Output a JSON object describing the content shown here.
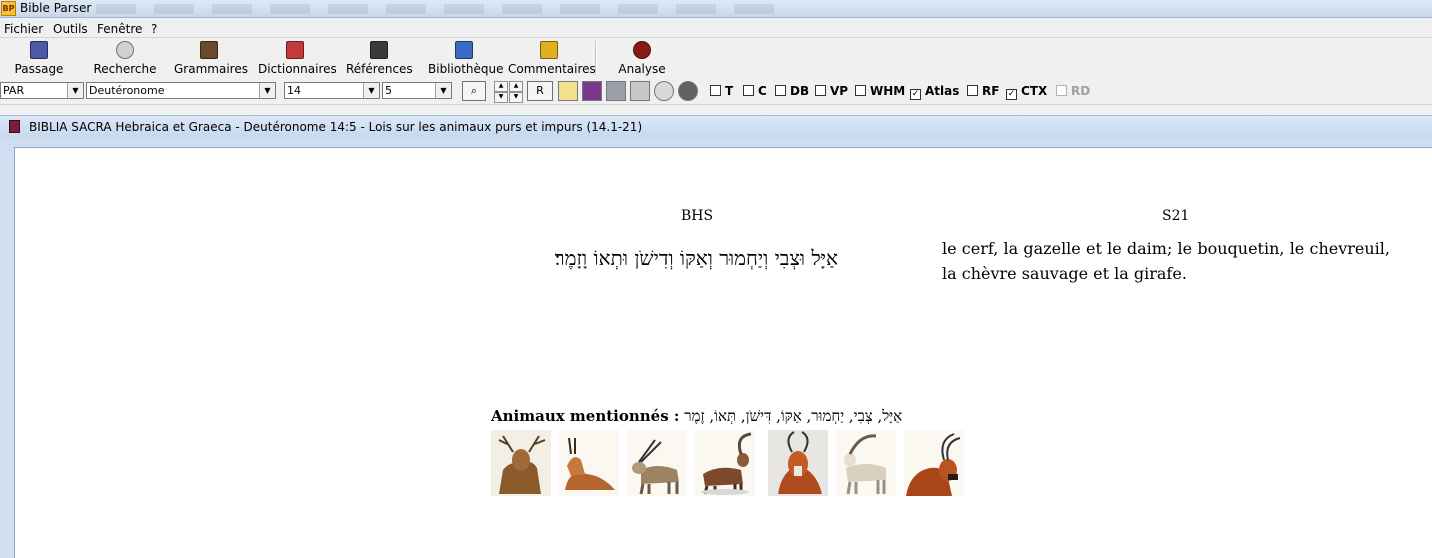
{
  "window": {
    "title": "Bible Parser",
    "app_icon_text": "BP"
  },
  "menu": [
    "Fichier",
    "Outils",
    "Fenêtre",
    "?"
  ],
  "toolbar": [
    {
      "label": "Passage",
      "icon": "book-icon",
      "color": "#4a5aa8"
    },
    {
      "label": "Recherche",
      "icon": "search-icon",
      "color": "#d0d0d0"
    },
    {
      "label": "Grammaires",
      "icon": "books-icon",
      "color": "#6b4a2a"
    },
    {
      "label": "Dictionnaires",
      "icon": "dictionary-icon",
      "color": "#c43a3a"
    },
    {
      "label": "Références",
      "icon": "scroll-icon",
      "color": "#3a3a3a"
    },
    {
      "label": "Bibliothèque",
      "icon": "library-icon",
      "color": "#3a6ac4"
    },
    {
      "label": "Commentaires",
      "icon": "commentary-icon",
      "color": "#e0b020"
    },
    {
      "label": "Analyse",
      "icon": "analysis-icon",
      "color": "#8a1a1a"
    }
  ],
  "options": {
    "version": "PAR",
    "book": "Deutéronome",
    "chapter": "14",
    "verse": "5",
    "r_button": "R",
    "checks": [
      {
        "label": "T",
        "checked": false,
        "disabled": false
      },
      {
        "label": "C",
        "checked": false,
        "disabled": false
      },
      {
        "label": "DB",
        "checked": false,
        "disabled": false
      },
      {
        "label": "VP",
        "checked": false,
        "disabled": false
      },
      {
        "label": "WHM",
        "checked": false,
        "disabled": false
      },
      {
        "label": "Atlas",
        "checked": true,
        "disabled": false
      },
      {
        "label": "RF",
        "checked": false,
        "disabled": false
      },
      {
        "label": "CTX",
        "checked": true,
        "disabled": false
      },
      {
        "label": "RD",
        "checked": false,
        "disabled": true
      }
    ]
  },
  "document": {
    "title": "BIBLIA SACRA Hebraica et Graeca - Deutéronome 14:5 - Lois sur les animaux purs et impurs (14.1-21)",
    "col1_header": "BHS",
    "col2_header": "S21",
    "hebrew_text": "אַיָּל וּצְבִי וְיַחְמוּר וְאַקּוֹ וְדִישֹׁן וּתְאוֹ וָזָמֶר׃",
    "french_text": "le cerf, la gazelle et le daim; le bouquetin, le chevreuil, la chèvre sauvage et la girafe.",
    "animals_label": "Animaux mentionnés :",
    "animals_hebrew": "אַיָּל, צְבִי, יַחְמוּר, אַקּוֹ, דִּישֹׁן, תְּאוֹ, זֶמֶר",
    "animal_images": [
      {
        "icon": "deer-icon",
        "color": "#8a5a2b"
      },
      {
        "icon": "gazelle-icon",
        "color": "#b5652e"
      },
      {
        "icon": "oryx-icon",
        "color": "#9c8462"
      },
      {
        "icon": "ibex-icon",
        "color": "#7a4a2a"
      },
      {
        "icon": "antelope-icon",
        "color": "#b04a1c"
      },
      {
        "icon": "wild-goat-icon",
        "color": "#d8cfbf"
      },
      {
        "icon": "sable-antelope-icon",
        "color": "#a8461a"
      }
    ]
  }
}
